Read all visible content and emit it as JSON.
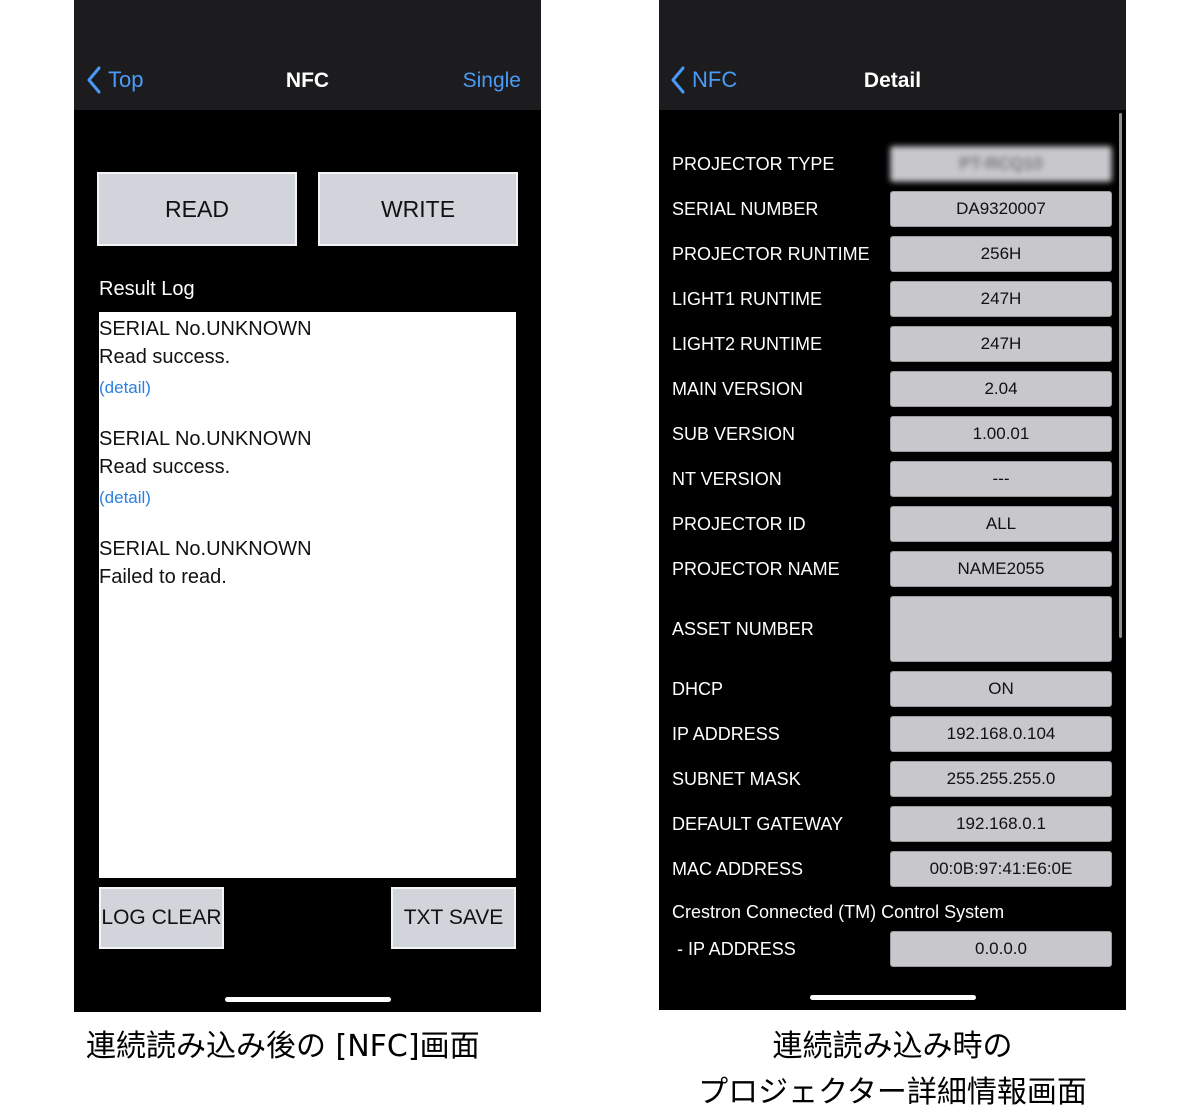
{
  "left_screen": {
    "nav": {
      "back_label": "Top",
      "title": "NFC",
      "right_label": "Single"
    },
    "buttons": {
      "read": "READ",
      "write": "WRITE",
      "log_clear": "LOG CLEAR",
      "txt_save": "TXT SAVE"
    },
    "result_log_label": "Result Log",
    "log_entries": [
      {
        "serial": "SERIAL No.UNKNOWN",
        "status": "Read success.",
        "link": "(detail)"
      },
      {
        "serial": "SERIAL No.UNKNOWN",
        "status": "Read success.",
        "link": "(detail)"
      },
      {
        "serial": "SERIAL No.UNKNOWN",
        "status": "Failed to read.",
        "link": ""
      }
    ],
    "caption": "連続読み込み後の [NFC]画面"
  },
  "right_screen": {
    "nav": {
      "back_label": "NFC",
      "title": "Detail"
    },
    "fields": [
      {
        "label": "PROJECTOR TYPE",
        "value": "PT-RCQ10"
      },
      {
        "label": "SERIAL NUMBER",
        "value": "DA9320007"
      },
      {
        "label": "PROJECTOR RUNTIME",
        "value": "256H"
      },
      {
        "label": "LIGHT1 RUNTIME",
        "value": "247H"
      },
      {
        "label": "LIGHT2 RUNTIME",
        "value": "247H"
      },
      {
        "label": "MAIN VERSION",
        "value": "2.04"
      },
      {
        "label": "SUB VERSION",
        "value": "1.00.01"
      },
      {
        "label": "NT VERSION",
        "value": "---"
      },
      {
        "label": "PROJECTOR ID",
        "value": "ALL"
      },
      {
        "label": "PROJECTOR NAME",
        "value": "NAME2055"
      },
      {
        "label": "ASSET NUMBER",
        "value": ""
      },
      {
        "label": "DHCP",
        "value": "ON"
      },
      {
        "label": "IP ADDRESS",
        "value": "192.168.0.104"
      },
      {
        "label": "SUBNET MASK",
        "value": "255.255.255.0"
      },
      {
        "label": "DEFAULT GATEWAY",
        "value": "192.168.0.1"
      },
      {
        "label": "MAC ADDRESS",
        "value": "00:0B:97:41:E6:0E"
      }
    ],
    "crestron_heading": "Crestron Connected (TM) Control System",
    "crestron_ip": {
      "label": "- IP ADDRESS",
      "value": "0.0.0.0"
    },
    "caption_line1": "連続読み込み時の",
    "caption_line2": "プロジェクター詳細情報画面"
  }
}
